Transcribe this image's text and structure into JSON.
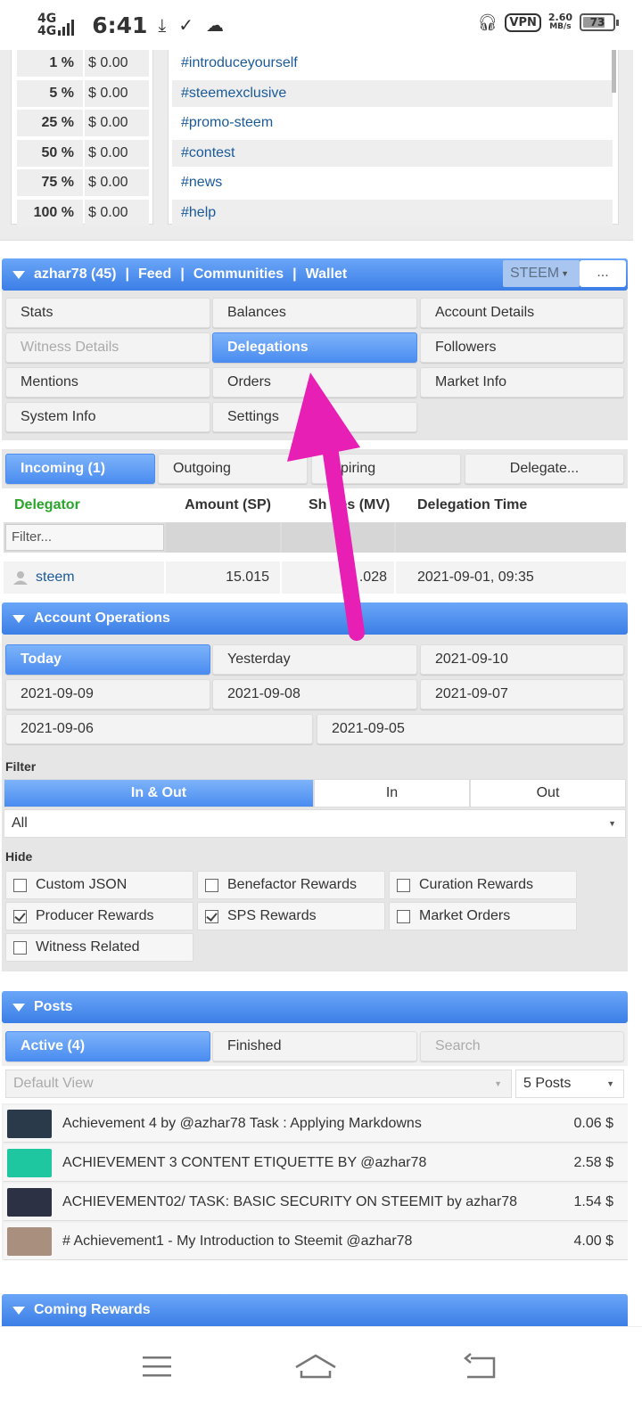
{
  "status_bar": {
    "net1": "4G",
    "net2": "4G",
    "time": "6:41",
    "vpn": "VPN",
    "speed_value": "2.60",
    "speed_unit": "MB/s",
    "battery": "73"
  },
  "percent_table": [
    {
      "pct": "1 %",
      "val": "$ 0.00"
    },
    {
      "pct": "5 %",
      "val": "$ 0.00"
    },
    {
      "pct": "25 %",
      "val": "$ 0.00"
    },
    {
      "pct": "50 %",
      "val": "$ 0.00"
    },
    {
      "pct": "75 %",
      "val": "$ 0.00"
    },
    {
      "pct": "100 %",
      "val": "$ 0.00"
    }
  ],
  "tags": [
    "#introduceyourself",
    "#steemexclusive",
    "#promo-steem",
    "#contest",
    "#news",
    "#help"
  ],
  "header": {
    "user": "azhar78 (45)",
    "sep": "|",
    "feed": "Feed",
    "communities": "Communities",
    "wallet": "Wallet",
    "currency": "STEEM",
    "more": "..."
  },
  "nav": {
    "stats": "Stats",
    "balances": "Balances",
    "account_details": "Account Details",
    "witness_details": "Witness Details",
    "delegations": "Delegations",
    "followers": "Followers",
    "mentions": "Mentions",
    "orders": "Orders",
    "market_info": "Market Info",
    "system_info": "System Info",
    "settings": "Settings"
  },
  "deleg_tabs": {
    "incoming": "Incoming (1)",
    "outgoing": "Outgoing",
    "expiring": "xpiring",
    "delegate": "Delegate..."
  },
  "deleg_table": {
    "headers": {
      "delegator": "Delegator",
      "amount": "Amount (SP)",
      "shares": "Sh",
      "shares_tail": "es (MV)",
      "time": "Delegation Time"
    },
    "filter_placeholder": "Filter...",
    "rows": [
      {
        "delegator": "steem",
        "amount": "15.015",
        "shares": ".028",
        "time": "2021-09-01, 09:35"
      }
    ]
  },
  "account_ops": {
    "title": "Account Operations",
    "dates": [
      "Today",
      "Yesterday",
      "2021-09-10",
      "2021-09-09",
      "2021-09-08",
      "2021-09-07",
      "2021-09-06",
      "2021-09-05"
    ],
    "filter_label": "Filter",
    "filter_opts": [
      "In & Out",
      "In",
      "Out"
    ],
    "filter_select": "All",
    "hide_label": "Hide",
    "hide_opts": [
      {
        "label": "Custom JSON",
        "checked": false
      },
      {
        "label": "Benefactor Rewards",
        "checked": false
      },
      {
        "label": "Curation Rewards",
        "checked": false
      },
      {
        "label": "Producer Rewards",
        "checked": true
      },
      {
        "label": "SPS Rewards",
        "checked": true
      },
      {
        "label": "Market Orders",
        "checked": false
      },
      {
        "label": "Witness Related",
        "checked": false
      }
    ]
  },
  "posts": {
    "title": "Posts",
    "tabs": {
      "active": "Active (4)",
      "finished": "Finished",
      "search": "Search"
    },
    "view_select": "Default View",
    "count_select": "5 Posts",
    "items": [
      {
        "title": "Achievement 4 by @azhar78 Task : Applying Markdowns",
        "value": "0.06 $"
      },
      {
        "title": "ACHIEVEMENT 3 CONTENT ETIQUETTE BY @azhar78",
        "value": "2.58 $"
      },
      {
        "title": "ACHIEVEMENT02/ TASK: BASIC SECURITY ON STEEMIT by azhar78",
        "value": "1.54 $"
      },
      {
        "title": "# Achievement1 - My Introduction to Steemit @azhar78",
        "value": "4.00 $"
      }
    ]
  },
  "coming_rewards": {
    "title": "Coming Rewards"
  },
  "colors": {
    "accent_blue": "#4a8cf0",
    "arrow": "#e81fb5",
    "delegator_green": "#2aa52a"
  },
  "icons": [
    "download-icon",
    "check-icon",
    "cloud-icon",
    "headphones-icon",
    "user-icon",
    "menu-icon",
    "home-icon",
    "back-icon"
  ]
}
